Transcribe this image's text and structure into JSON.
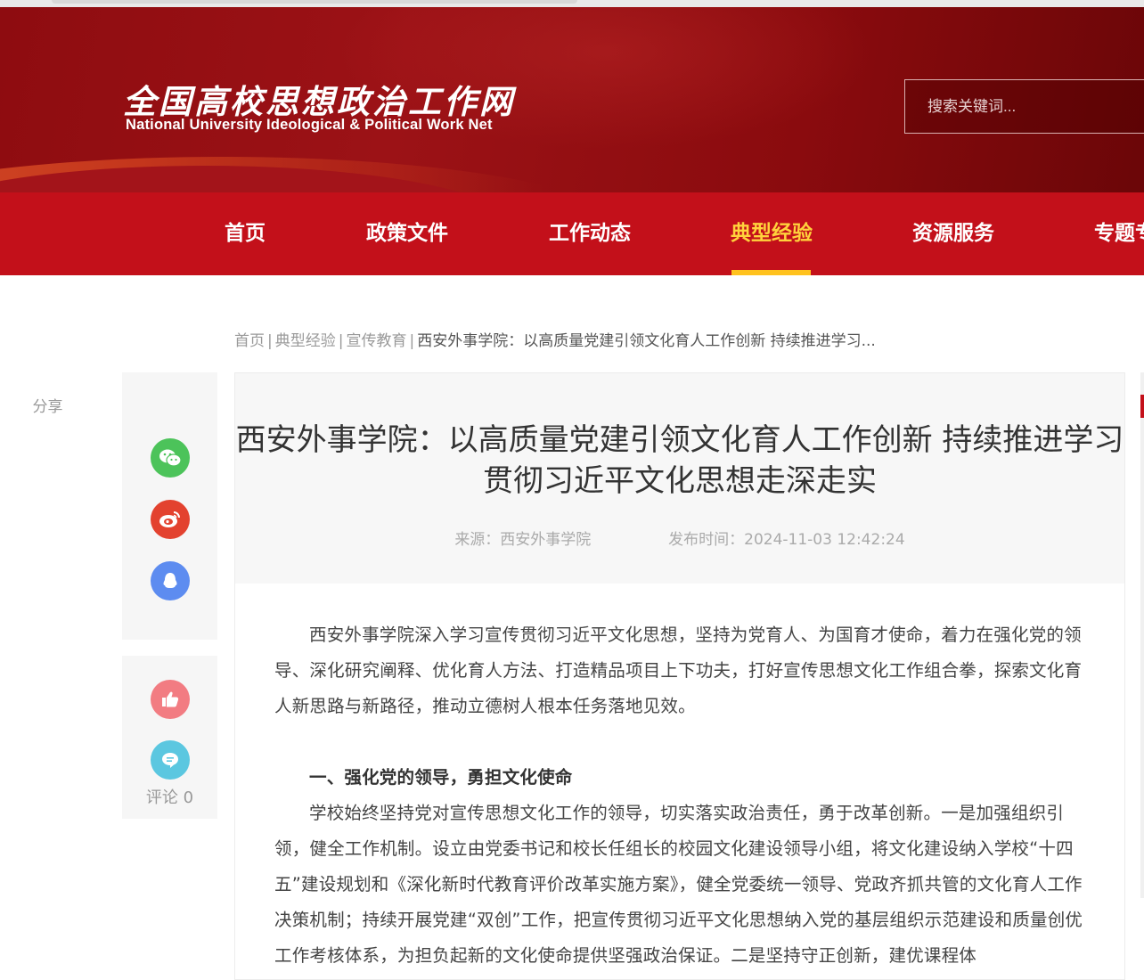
{
  "header": {
    "logo_cn": "全国高校思想政治工作网",
    "logo_en": "National University Ideological & Political Work Net",
    "search_placeholder": "搜索关键词..."
  },
  "nav": {
    "items": [
      {
        "label": "首页"
      },
      {
        "label": "政策文件"
      },
      {
        "label": "工作动态"
      },
      {
        "label": "典型经验",
        "active": true
      },
      {
        "label": "资源服务"
      },
      {
        "label": "专题专"
      }
    ],
    "active_color": "#ffd23c"
  },
  "breadcrumb": {
    "items": [
      "首页",
      "典型经验",
      "宣传教育"
    ],
    "current": "西安外事学院：以高质量党建引领文化育人工作创新 持续推进学习...",
    "sep": "|"
  },
  "sidebar": {
    "share_label": "分享",
    "share_icons": [
      "wechat-icon",
      "weibo-icon",
      "qq-icon"
    ],
    "comment_label": "评论 0"
  },
  "article": {
    "title": "西安外事学院：以高质量党建引领文化育人工作创新 持续推进学习贯彻习近平文化思想走深走实",
    "source": "来源：西安外事学院",
    "publish_time": "发布时间：2024-11-03 12:42:24",
    "paragraphs": [
      "西安外事学院深入学习宣传贯彻习近平文化思想，坚持为党育人、为国育才使命，着力在强化党的领导、深化研究阐释、优化育人方法、打造精品项目上下功夫，打好宣传思想文化工作组合拳，探索文化育人新思路与新路径，推动立德树人根本任务落地见效。",
      "一、强化党的领导，勇担文化使命",
      "学校始终坚持党对宣传思想文化工作的领导，切实落实政治责任，勇于改革创新。一是加强组织引领，健全工作机制。设立由党委书记和校长任组长的校园文化建设领导小组，将文化建设纳入学校“十四五”建设规划和《深化新时代教育评价改革实施方案》，健全党委统一领导、党政齐抓共管的文化育人工作决策机制；持续开展党建“双创”工作，把宣传贯彻习近平文化思想纳入党的基层组织示范建设和质量创优工作考核体系，为担负起新的文化使命提供坚强政治保证。二是坚持守正创新，建优课程体"
    ]
  },
  "colors": {
    "brand_red": "#c3101a",
    "banner_red": "#8e0c10",
    "wechat": "#4cc35a",
    "weibo": "#e3422f",
    "qq": "#5d8cf0",
    "like": "#f27c82",
    "comment": "#5bc7e0"
  }
}
